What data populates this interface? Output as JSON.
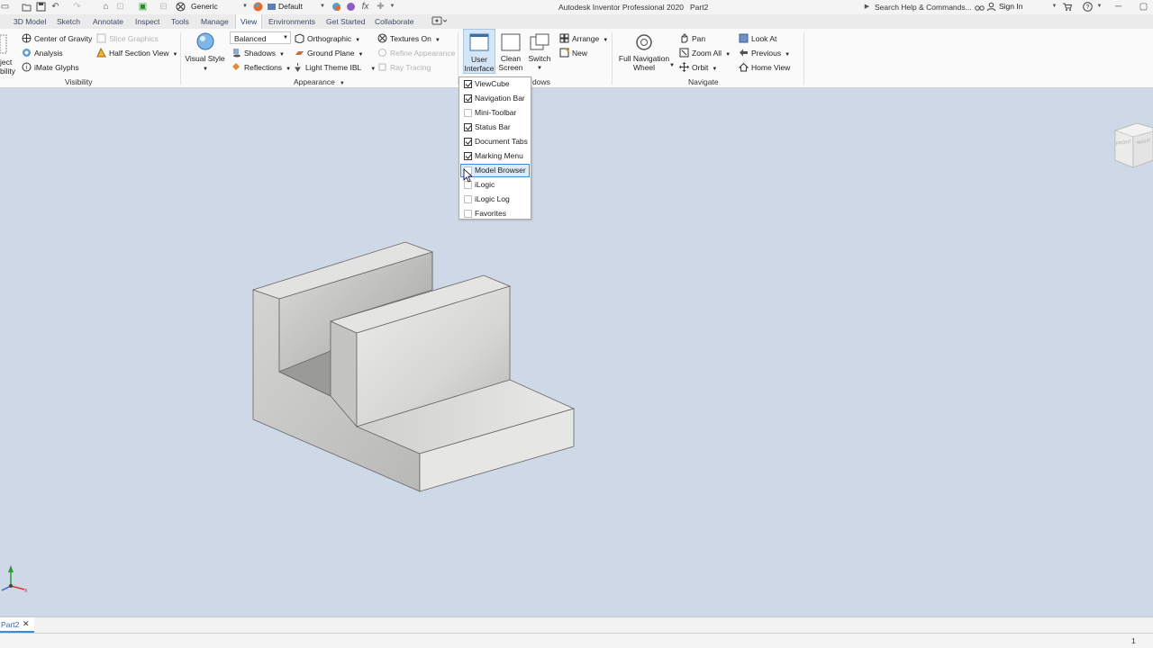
{
  "titlebar": {
    "material": "Generic",
    "appearance": "Default",
    "title": "Autodesk Inventor Professional 2020",
    "document": "Part2",
    "search_placeholder": "Search Help & Commands...",
    "sign_in": "Sign In"
  },
  "tabs": [
    "3D Model",
    "Sketch",
    "Annotate",
    "Inspect",
    "Tools",
    "Manage",
    "View",
    "Environments",
    "Get Started",
    "Collaborate"
  ],
  "ribbon": {
    "visibility": {
      "partial_top": "ject",
      "partial_bottom": "bility",
      "center_of_gravity": "Center of Gravity",
      "slice_graphics": "Slice Graphics",
      "analysis": "Analysis",
      "half_section_view": "Half Section View",
      "imate_glyphs": "iMate Glyphs",
      "title": "Visibility"
    },
    "appearance": {
      "visual_style": "Visual Style",
      "quality": "Balanced",
      "orthographic": "Orthographic",
      "textures_on": "Textures On",
      "shadows": "Shadows",
      "ground_plane": "Ground Plane",
      "refine_appearance": "Refine Appearance",
      "reflections": "Reflections",
      "light_theme": "Light Theme IBL",
      "ray_tracing": "Ray Tracing",
      "title": "Appearance"
    },
    "windows": {
      "user_interface_1": "User",
      "user_interface_2": "Interface",
      "clean_screen_1": "Clean",
      "clean_screen_2": "Screen",
      "switch": "Switch",
      "arrange": "Arrange",
      "new": "New",
      "title_partial": "dows"
    },
    "navigate": {
      "full_nav_wheel_1": "Full Navigation",
      "full_nav_wheel_2": "Wheel",
      "pan": "Pan",
      "zoom_all": "Zoom All",
      "orbit": "Orbit",
      "look_at": "Look At",
      "previous": "Previous",
      "home_view": "Home View",
      "title": "Navigate"
    }
  },
  "ui_menu": [
    {
      "label": "ViewCube",
      "checked": true
    },
    {
      "label": "Navigation Bar",
      "checked": true
    },
    {
      "label": "Mini-Toolbar",
      "checked": false
    },
    {
      "label": "Status Bar",
      "checked": true
    },
    {
      "label": "Document Tabs",
      "checked": true
    },
    {
      "label": "Marking Menu",
      "checked": true
    },
    {
      "label": "Model Browser",
      "checked": false,
      "highlighted": true
    },
    {
      "label": "iLogic",
      "checked": false
    },
    {
      "label": "iLogic Log",
      "checked": false
    },
    {
      "label": "Favorites",
      "checked": false
    }
  ],
  "viewcube": {
    "front": "FRONT",
    "right": "RIGHT"
  },
  "doc_tab": {
    "name": "Part2"
  },
  "status": {
    "count": "1"
  },
  "colors": {
    "accent": "#3c8ad8",
    "viewport_bg": "#cfd8e6"
  }
}
